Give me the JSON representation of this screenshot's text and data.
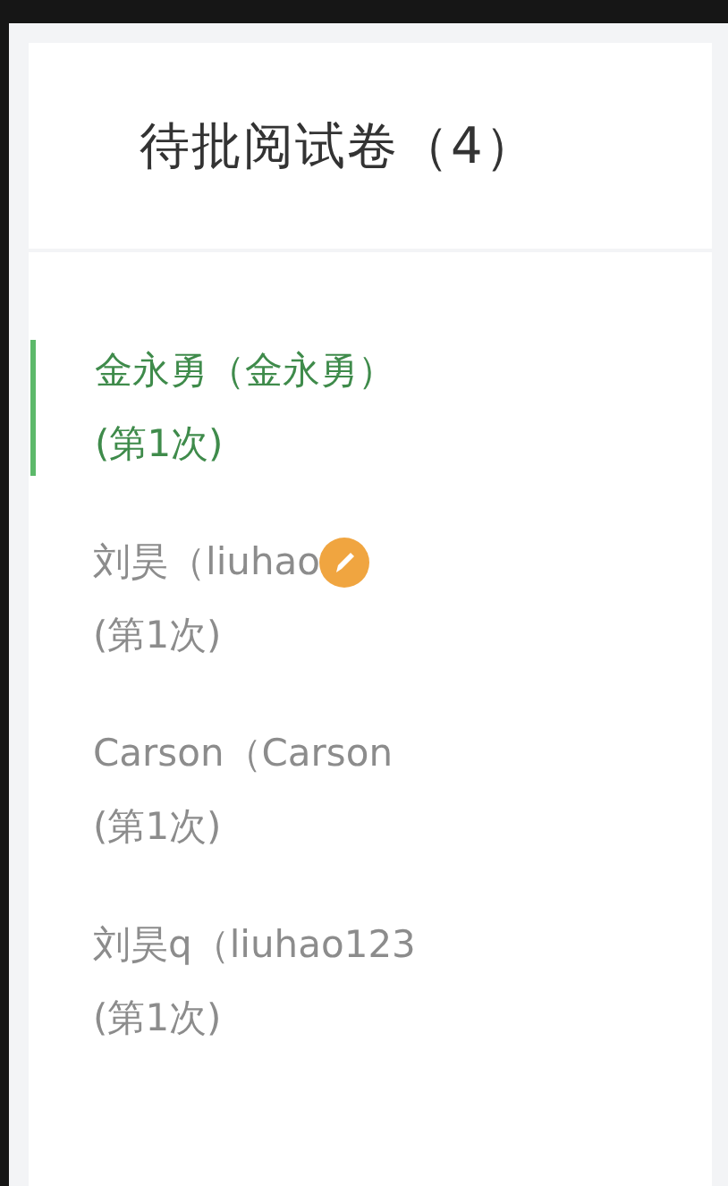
{
  "header": {
    "title": "待批阅试卷（4）"
  },
  "papers": [
    {
      "name": "金永勇（金永勇）",
      "attempt": "(第1次)",
      "selected": true,
      "marked": false
    },
    {
      "name": "刘昊（liuhao",
      "attempt": "(第1次)",
      "selected": false,
      "marked": true
    },
    {
      "name": "Carson（Carson",
      "attempt": "(第1次)",
      "selected": false,
      "marked": false
    },
    {
      "name": "刘昊q（liuhao123",
      "attempt": "(第1次)",
      "selected": false,
      "marked": false
    }
  ]
}
